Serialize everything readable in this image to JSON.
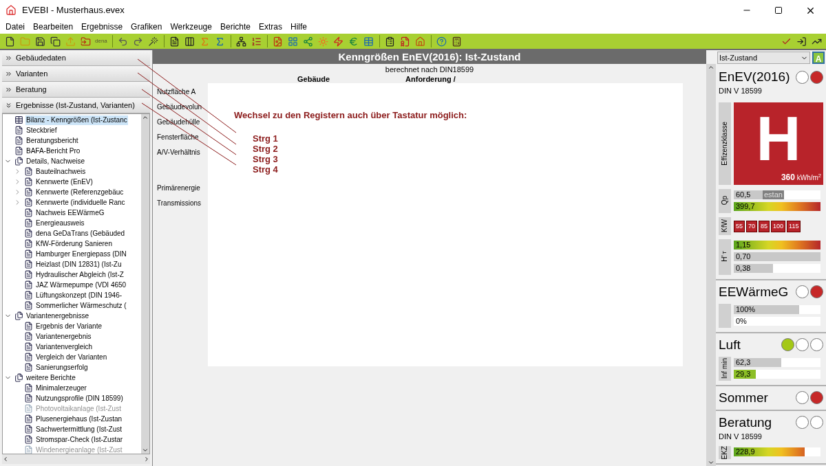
{
  "window": {
    "title": "EVEBI - Musterhaus.evex"
  },
  "menu": [
    "Datei",
    "Bearbeiten",
    "Ergebnisse",
    "Grafiken",
    "Werkzeuge",
    "Berichte",
    "Extras",
    "Hilfe"
  ],
  "toolbar": {
    "text_button": "dena"
  },
  "accordion": [
    {
      "label": "Gebäudedaten",
      "expanded": false
    },
    {
      "label": "Varianten",
      "expanded": false
    },
    {
      "label": "Beratung",
      "expanded": false
    },
    {
      "label": "Ergebnisse (Ist-Zustand, Varianten)",
      "expanded": true
    }
  ],
  "tree": [
    {
      "label": "Bilanz - Kenngrößen (Ist-Zustanc",
      "selected": true,
      "disabled": false
    },
    {
      "label": "Steckbrief",
      "selected": false,
      "disabled": false
    },
    {
      "label": "Beratungsbericht",
      "selected": false,
      "disabled": false
    },
    {
      "label": "BAFA-Bericht Pro",
      "selected": false,
      "disabled": false
    },
    {
      "label": "Details, Nachweise",
      "selected": false,
      "disabled": false,
      "expanded": true,
      "children": [
        {
          "label": "Bauteilnachweis",
          "selected": false,
          "disabled": false,
          "expanded": false
        },
        {
          "label": "Kennwerte (EnEV)",
          "selected": false,
          "disabled": false,
          "expanded": false
        },
        {
          "label": "Kennwerte (Referenzgebäuc",
          "selected": false,
          "disabled": false,
          "expanded": false
        },
        {
          "label": "Kennwerte (individuelle Ranc",
          "selected": false,
          "disabled": false,
          "expanded": false
        },
        {
          "label": "Nachweis EEWärmeG",
          "selected": false,
          "disabled": false
        },
        {
          "label": "Energieausweis",
          "selected": false,
          "disabled": false
        },
        {
          "label": "dena GeDaTrans (Gebäuded",
          "selected": false,
          "disabled": false
        },
        {
          "label": "KfW-Förderung Sanieren",
          "selected": false,
          "disabled": false
        },
        {
          "label": "Hamburger Energiepass (DIN",
          "selected": false,
          "disabled": false
        },
        {
          "label": "Heizlast (DIN 12831) (Ist-Zu",
          "selected": false,
          "disabled": false
        },
        {
          "label": "Hydraulischer Abgleich (Ist-Z",
          "selected": false,
          "disabled": false
        },
        {
          "label": "JAZ Wärmepumpe (VDI 4650",
          "selected": false,
          "disabled": false
        },
        {
          "label": "Lüftungskonzept (DIN 1946-",
          "selected": false,
          "disabled": false
        },
        {
          "label": "Sommerlicher Wärmeschutz (",
          "selected": false,
          "disabled": false
        }
      ]
    },
    {
      "label": "Variantenergebnisse",
      "selected": false,
      "disabled": false,
      "expanded": true,
      "children": [
        {
          "label": "Ergebnis der Variante",
          "selected": false,
          "disabled": false
        },
        {
          "label": "Variantenergebnis",
          "selected": false,
          "disabled": false
        },
        {
          "label": "Variantenvergleich",
          "selected": false,
          "disabled": false
        },
        {
          "label": "Vergleich der Varianten",
          "selected": false,
          "disabled": false
        },
        {
          "label": "Sanierungserfolg",
          "selected": false,
          "disabled": false
        }
      ]
    },
    {
      "label": "weitere Berichte",
      "selected": false,
      "disabled": false,
      "expanded": true,
      "children": [
        {
          "label": "Minimalerzeuger",
          "selected": false,
          "disabled": false
        },
        {
          "label": "Nutzungsprofile (DIN 18599)",
          "selected": false,
          "disabled": false
        },
        {
          "label": "Photovoltaikanlage (Ist-Zust",
          "selected": false,
          "disabled": true
        },
        {
          "label": "Plusenergiehaus (Ist-Zustan",
          "selected": false,
          "disabled": false
        },
        {
          "label": "Sachwertermittlung (Ist-Zust",
          "selected": false,
          "disabled": false
        },
        {
          "label": "Stromspar-Check (Ist-Zustar",
          "selected": false,
          "disabled": false
        },
        {
          "label": "Windenergieanlage (Ist-Zust",
          "selected": false,
          "disabled": true
        }
      ]
    }
  ],
  "main": {
    "title": "Kenngrößen EnEV(2016): Ist-Zustand",
    "subtitle": "berechnet nach DIN18599",
    "column_headers": [
      "Gebäude",
      "Anforderung /"
    ],
    "row_labels": [
      "Nutzfläche A",
      "Gebäudevolun",
      "Gebäudehülle",
      "Fensterfläche",
      "A/V-Verhältnis",
      "Primärenergie",
      "Transmissions"
    ],
    "hint": {
      "text": "Wechsel zu den Registern auch über Tastatur möglich:",
      "shortcuts": [
        "Strg 1",
        "Strg 2",
        "Strg 3",
        "Strg 4"
      ]
    }
  },
  "side": {
    "dropdown": "Ist-Zustand",
    "class_button": "A",
    "sections": [
      {
        "title": "EnEV(2016)",
        "lights": [
          {
            "color": "#ffffff"
          },
          {
            "color": "#c62828"
          }
        ],
        "subtitle": "DIN V 18599",
        "efficiency": {
          "label": "Effizenzklasse",
          "letter": "H",
          "value": "360",
          "unit": "kWh/m$^{2}$"
        },
        "groups": [
          {
            "label": "Qp",
            "rows": [
              {
                "kind": "gray",
                "value": "60,5",
                "level": 0.45,
                "tag": "estan"
              },
              {
                "kind": "gradient",
                "value": "399,7",
                "level": 1
              }
            ]
          },
          {
            "label": "KfW",
            "boxes": [
              "55",
              "70",
              "85",
              "100",
              "115"
            ]
          },
          {
            "label": "H'$_{T}$",
            "rows": [
              {
                "kind": "gradient",
                "value": "1,15",
                "level": 1
              },
              {
                "kind": "gray",
                "value": "0,70",
                "level": 1
              },
              {
                "kind": "gray",
                "value": "0,38",
                "level": 0.45
              }
            ]
          }
        ]
      },
      {
        "title": "EEWärmeG",
        "lights": [
          {
            "color": "#ffffff"
          },
          {
            "color": "#c62828"
          }
        ],
        "groups": [
          {
            "rows": [
              {
                "kind": "gray",
                "value": "100%",
                "level": 0.75
              },
              {
                "kind": "gray",
                "value": "0%",
                "level": 0
              }
            ]
          }
        ]
      },
      {
        "title": "Luft",
        "lights": [
          {
            "color": "#a4c817"
          },
          {
            "color": "#ffffff"
          },
          {
            "color": "#ffffff"
          }
        ],
        "groups": [
          {
            "label": "Inf min",
            "rows": [
              {
                "kind": "gray",
                "value": "62,3",
                "level": 0.55
              },
              {
                "kind": "green",
                "value": "29,3",
                "level": 0.25
              }
            ]
          }
        ]
      },
      {
        "title": "Sommer",
        "lights": [
          {
            "color": "#ffffff"
          },
          {
            "color": "#c62828"
          }
        ]
      },
      {
        "title": "Beratung",
        "lights": [
          {
            "color": "#ffffff"
          },
          {
            "color": "#ffffff"
          }
        ],
        "subtitle": "DIN V 18599",
        "groups": [
          {
            "label": "EKZ",
            "rows": [
              {
                "kind": "gradient",
                "value": "228,9",
                "level": 0.82
              }
            ]
          }
        ]
      }
    ]
  }
}
